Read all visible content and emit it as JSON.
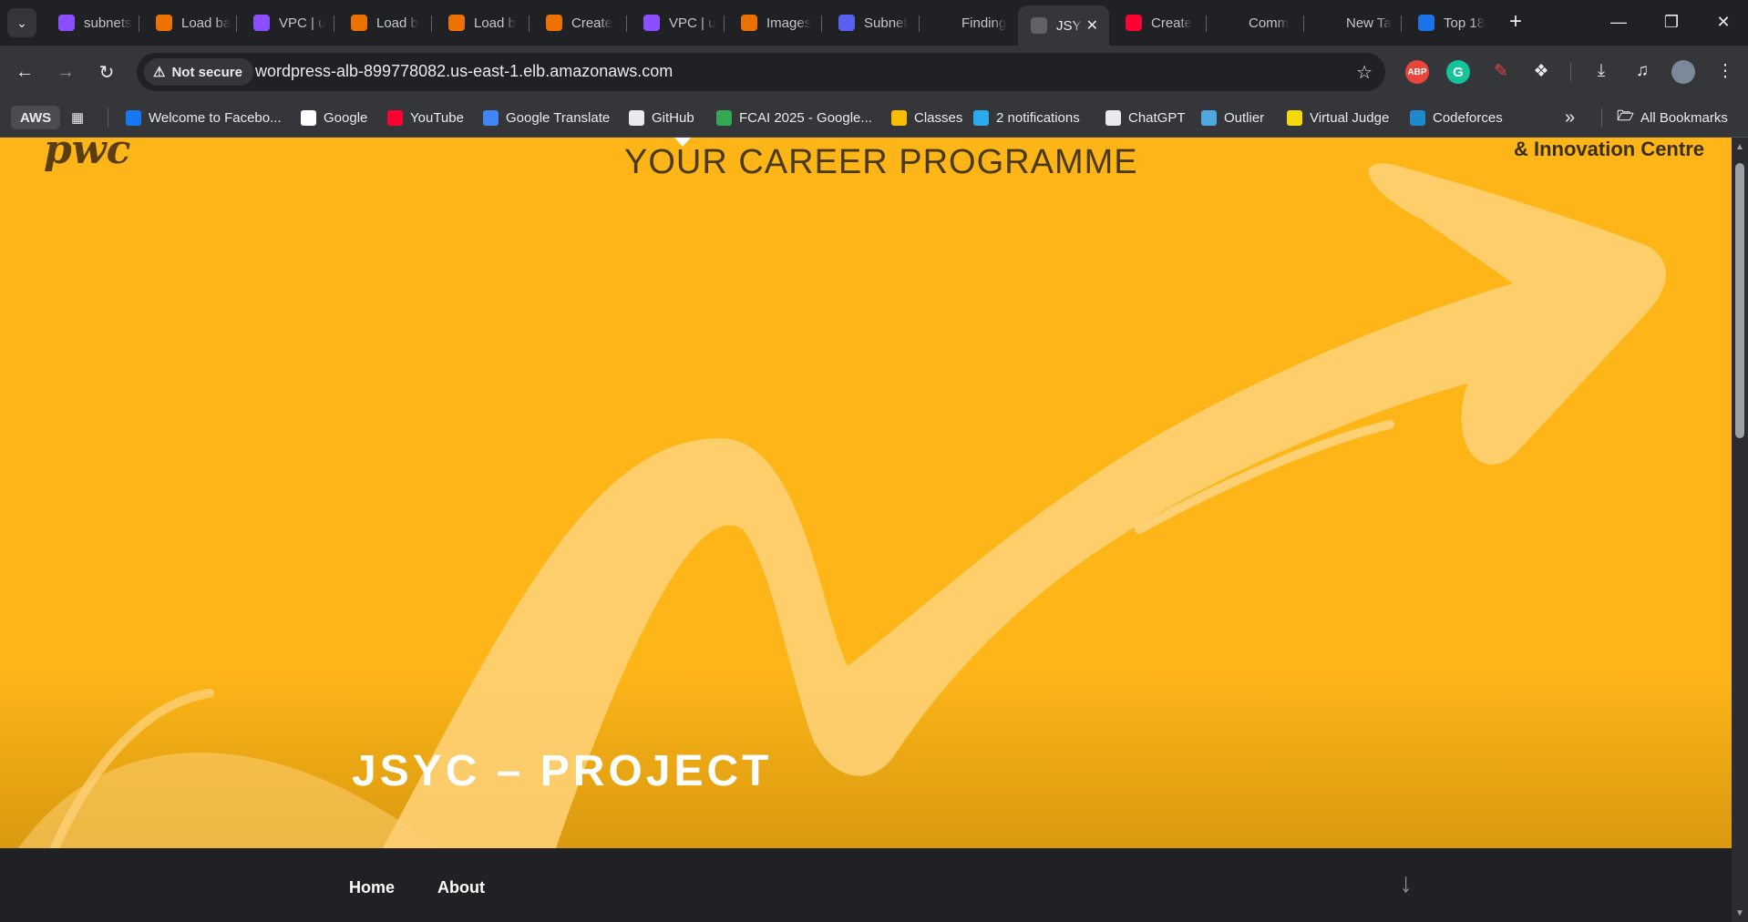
{
  "tabs": [
    {
      "title": "subnets",
      "icon": "vpc-icon",
      "color": "#8c4fff"
    },
    {
      "title": "Load ba",
      "icon": "ec2-icon",
      "color": "#ed7100"
    },
    {
      "title": "VPC | u",
      "icon": "vpc-icon",
      "color": "#8c4fff"
    },
    {
      "title": "Load b",
      "icon": "ec2-icon",
      "color": "#ed7100"
    },
    {
      "title": "Load b",
      "icon": "ec2-icon",
      "color": "#ed7100"
    },
    {
      "title": "Create",
      "icon": "ec2-icon",
      "color": "#ed7100"
    },
    {
      "title": "VPC | u",
      "icon": "vpc-icon",
      "color": "#8c4fff"
    },
    {
      "title": "Images",
      "icon": "ec2-icon",
      "color": "#ed7100"
    },
    {
      "title": "Subnet",
      "icon": "subnet-icon",
      "color": "#5a5ff0"
    },
    {
      "title": "Finding",
      "icon": "t-icon",
      "color": "#202124"
    },
    {
      "title": "JSY",
      "icon": "globe-icon",
      "color": "#5f6368",
      "active": true
    },
    {
      "title": "Create",
      "icon": "youtube-icon",
      "color": "#ff0033"
    },
    {
      "title": "Comm",
      "icon": "github-icon",
      "color": "#202124"
    },
    {
      "title": "New Ta",
      "icon": "chrome-icon",
      "color": "#202124"
    },
    {
      "title": "Top 18",
      "icon": "bookmark-app-icon",
      "color": "#1a73e8"
    }
  ],
  "toolbar": {
    "security_label": "Not secure",
    "url": "wordpress-alb-899778082.us-east-1.elb.amazonaws.com"
  },
  "bookmarks": {
    "aws_label": "AWS",
    "items": [
      {
        "label": "Welcome to Facebo...",
        "icon": "facebook-icon",
        "color": "#1877f2"
      },
      {
        "label": "Google",
        "icon": "google-icon",
        "color": "#ffffff"
      },
      {
        "label": "YouTube",
        "icon": "youtube-icon",
        "color": "#ff0033"
      },
      {
        "label": "Google Translate",
        "icon": "translate-icon",
        "color": "#4285f4"
      },
      {
        "label": "GitHub",
        "icon": "github-icon",
        "color": "#e8eaed"
      },
      {
        "label": "FCAI 2025 - Google...",
        "icon": "drive-icon",
        "color": "#34a853"
      },
      {
        "label": "Classes",
        "icon": "classroom-icon",
        "color": "#fbbc04"
      },
      {
        "label": "2 notifications",
        "icon": "telegram-icon",
        "color": "#2aabee"
      },
      {
        "label": "ChatGPT",
        "icon": "chatgpt-icon",
        "color": "#e8eaed"
      },
      {
        "label": "Outlier",
        "icon": "outlier-icon",
        "color": "#4ea8de"
      },
      {
        "label": "Virtual Judge",
        "icon": "vjudge-icon",
        "color": "#f5d90a"
      },
      {
        "label": "Codeforces",
        "icon": "codeforces-icon",
        "color": "#1f8acb"
      }
    ],
    "all_bookmarks_label": "All Bookmarks"
  },
  "page": {
    "banner_tagline": "YOUR CAREER PROGRAMME",
    "banner_corner_text": "& Innovation Centre",
    "banner_logo_text": "pwc",
    "hero_title": "JSYC – PROJECT",
    "nav": {
      "home": "Home",
      "about": "About"
    },
    "colors": {
      "hero": "#fdb518",
      "arrow": "#fdd073",
      "nav_bg": "#202124"
    }
  }
}
